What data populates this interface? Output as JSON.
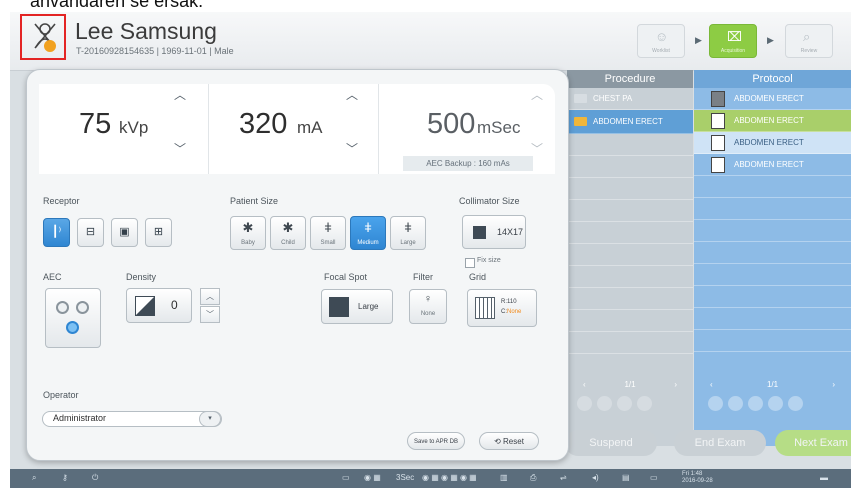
{
  "caption": "användaren se ersak.",
  "header": {
    "patient_name": "Lee Samsung",
    "patient_meta": "T-20160928154635 | 1969-11-01 | Male",
    "patient_badge": "",
    "workflow": [
      {
        "label": "Worklist",
        "icon": "person-group-icon",
        "active": false
      },
      {
        "label": "Acquisition",
        "icon": "acquisition-icon",
        "active": true
      },
      {
        "label": "Review",
        "icon": "review-icon",
        "active": false
      }
    ]
  },
  "exposure": {
    "kvp": {
      "value": "75",
      "unit": "kVp"
    },
    "ma": {
      "value": "320",
      "unit": "mA"
    },
    "msec": {
      "value": "500",
      "unit": "mSec"
    },
    "aec_backup": "AEC Backup : 160 mAs"
  },
  "labels": {
    "receptor": "Receptor",
    "patient_size": "Patient Size",
    "collimator_size": "Collimator Size",
    "aec": "AEC",
    "density": "Density",
    "focal_spot": "Focal Spot",
    "filter": "Filter",
    "grid": "Grid",
    "operator": "Operator",
    "fix_size": "Fix size"
  },
  "patient_sizes": [
    {
      "label": "Baby",
      "selected": false
    },
    {
      "label": "Child",
      "selected": false
    },
    {
      "label": "Small",
      "selected": false
    },
    {
      "label": "Medium",
      "selected": true
    },
    {
      "label": "Large",
      "selected": false
    }
  ],
  "collimator": {
    "value": "14X17"
  },
  "density": {
    "value": "0"
  },
  "focal_spot": {
    "value": "Large"
  },
  "filter": {
    "value": "None"
  },
  "grid": {
    "r": "R:110",
    "c_prefix": "C:",
    "c_value": "None"
  },
  "operator": {
    "value": "Administrator"
  },
  "panel_buttons": {
    "save": "Save to APR DB",
    "reset": "Reset"
  },
  "procedure": {
    "title": "Procedure",
    "items": [
      {
        "label": "CHEST PA",
        "selected": false
      },
      {
        "label": "ABDOMEN ERECT",
        "selected": true
      }
    ],
    "pager": "1/1"
  },
  "protocol": {
    "title": "Protocol",
    "items": [
      {
        "label": "ABDOMEN ERECT"
      },
      {
        "label": "ABDOMEN ERECT"
      },
      {
        "label": "ABDOMEN ERECT"
      },
      {
        "label": "ABDOMEN ERECT"
      }
    ],
    "pager": "1/1"
  },
  "actions": {
    "suspend": "Suspend",
    "end_exam": "End Exam",
    "next": "Next Exam"
  },
  "taskbar": {
    "exposure_time": "3Sec",
    "clock_time": "Fri 1:48",
    "clock_date": "2016-09-28"
  }
}
